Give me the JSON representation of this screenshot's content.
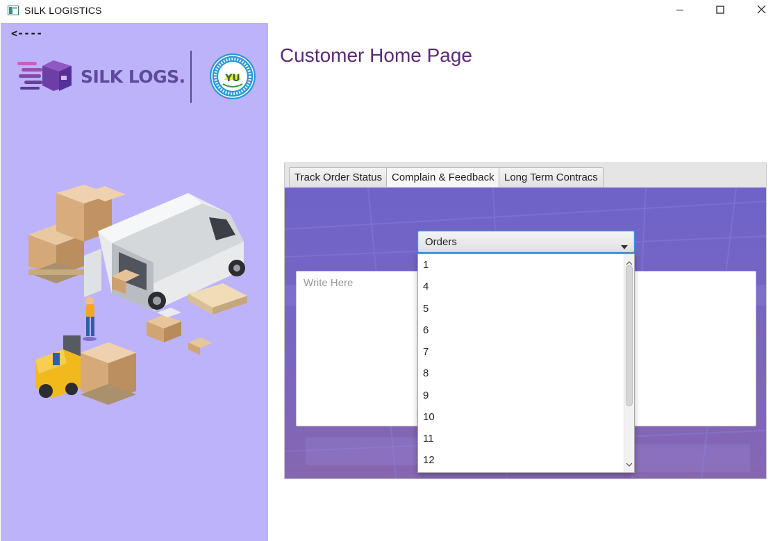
{
  "window": {
    "title": "SILK LOGISTICS",
    "icon": "app-window-icon",
    "controls": [
      "minimize-icon",
      "maximize-icon",
      "close-icon"
    ]
  },
  "sidebar": {
    "back_label": "<----",
    "logo_text": "SILK LOGS.",
    "logo_icon": "delivery-box-icon",
    "seal_icon": "university-seal-logo",
    "illustration": "warehouse-delivery-van-illustration",
    "background_color": "#bdb3fb"
  },
  "main": {
    "page_title": "Customer Home Page",
    "title_color": "#5c2a78",
    "tabs": [
      {
        "label": "Track Order Status",
        "active": false
      },
      {
        "label": "Complain & Feedback",
        "active": true
      },
      {
        "label": "Long Term Contracs",
        "active": false
      }
    ],
    "feedback": {
      "placeholder": "Write Here"
    },
    "orders_combo": {
      "selected": "Orders",
      "options": [
        "1",
        "4",
        "5",
        "6",
        "7",
        "8",
        "9",
        "10",
        "11",
        "12"
      ]
    }
  }
}
